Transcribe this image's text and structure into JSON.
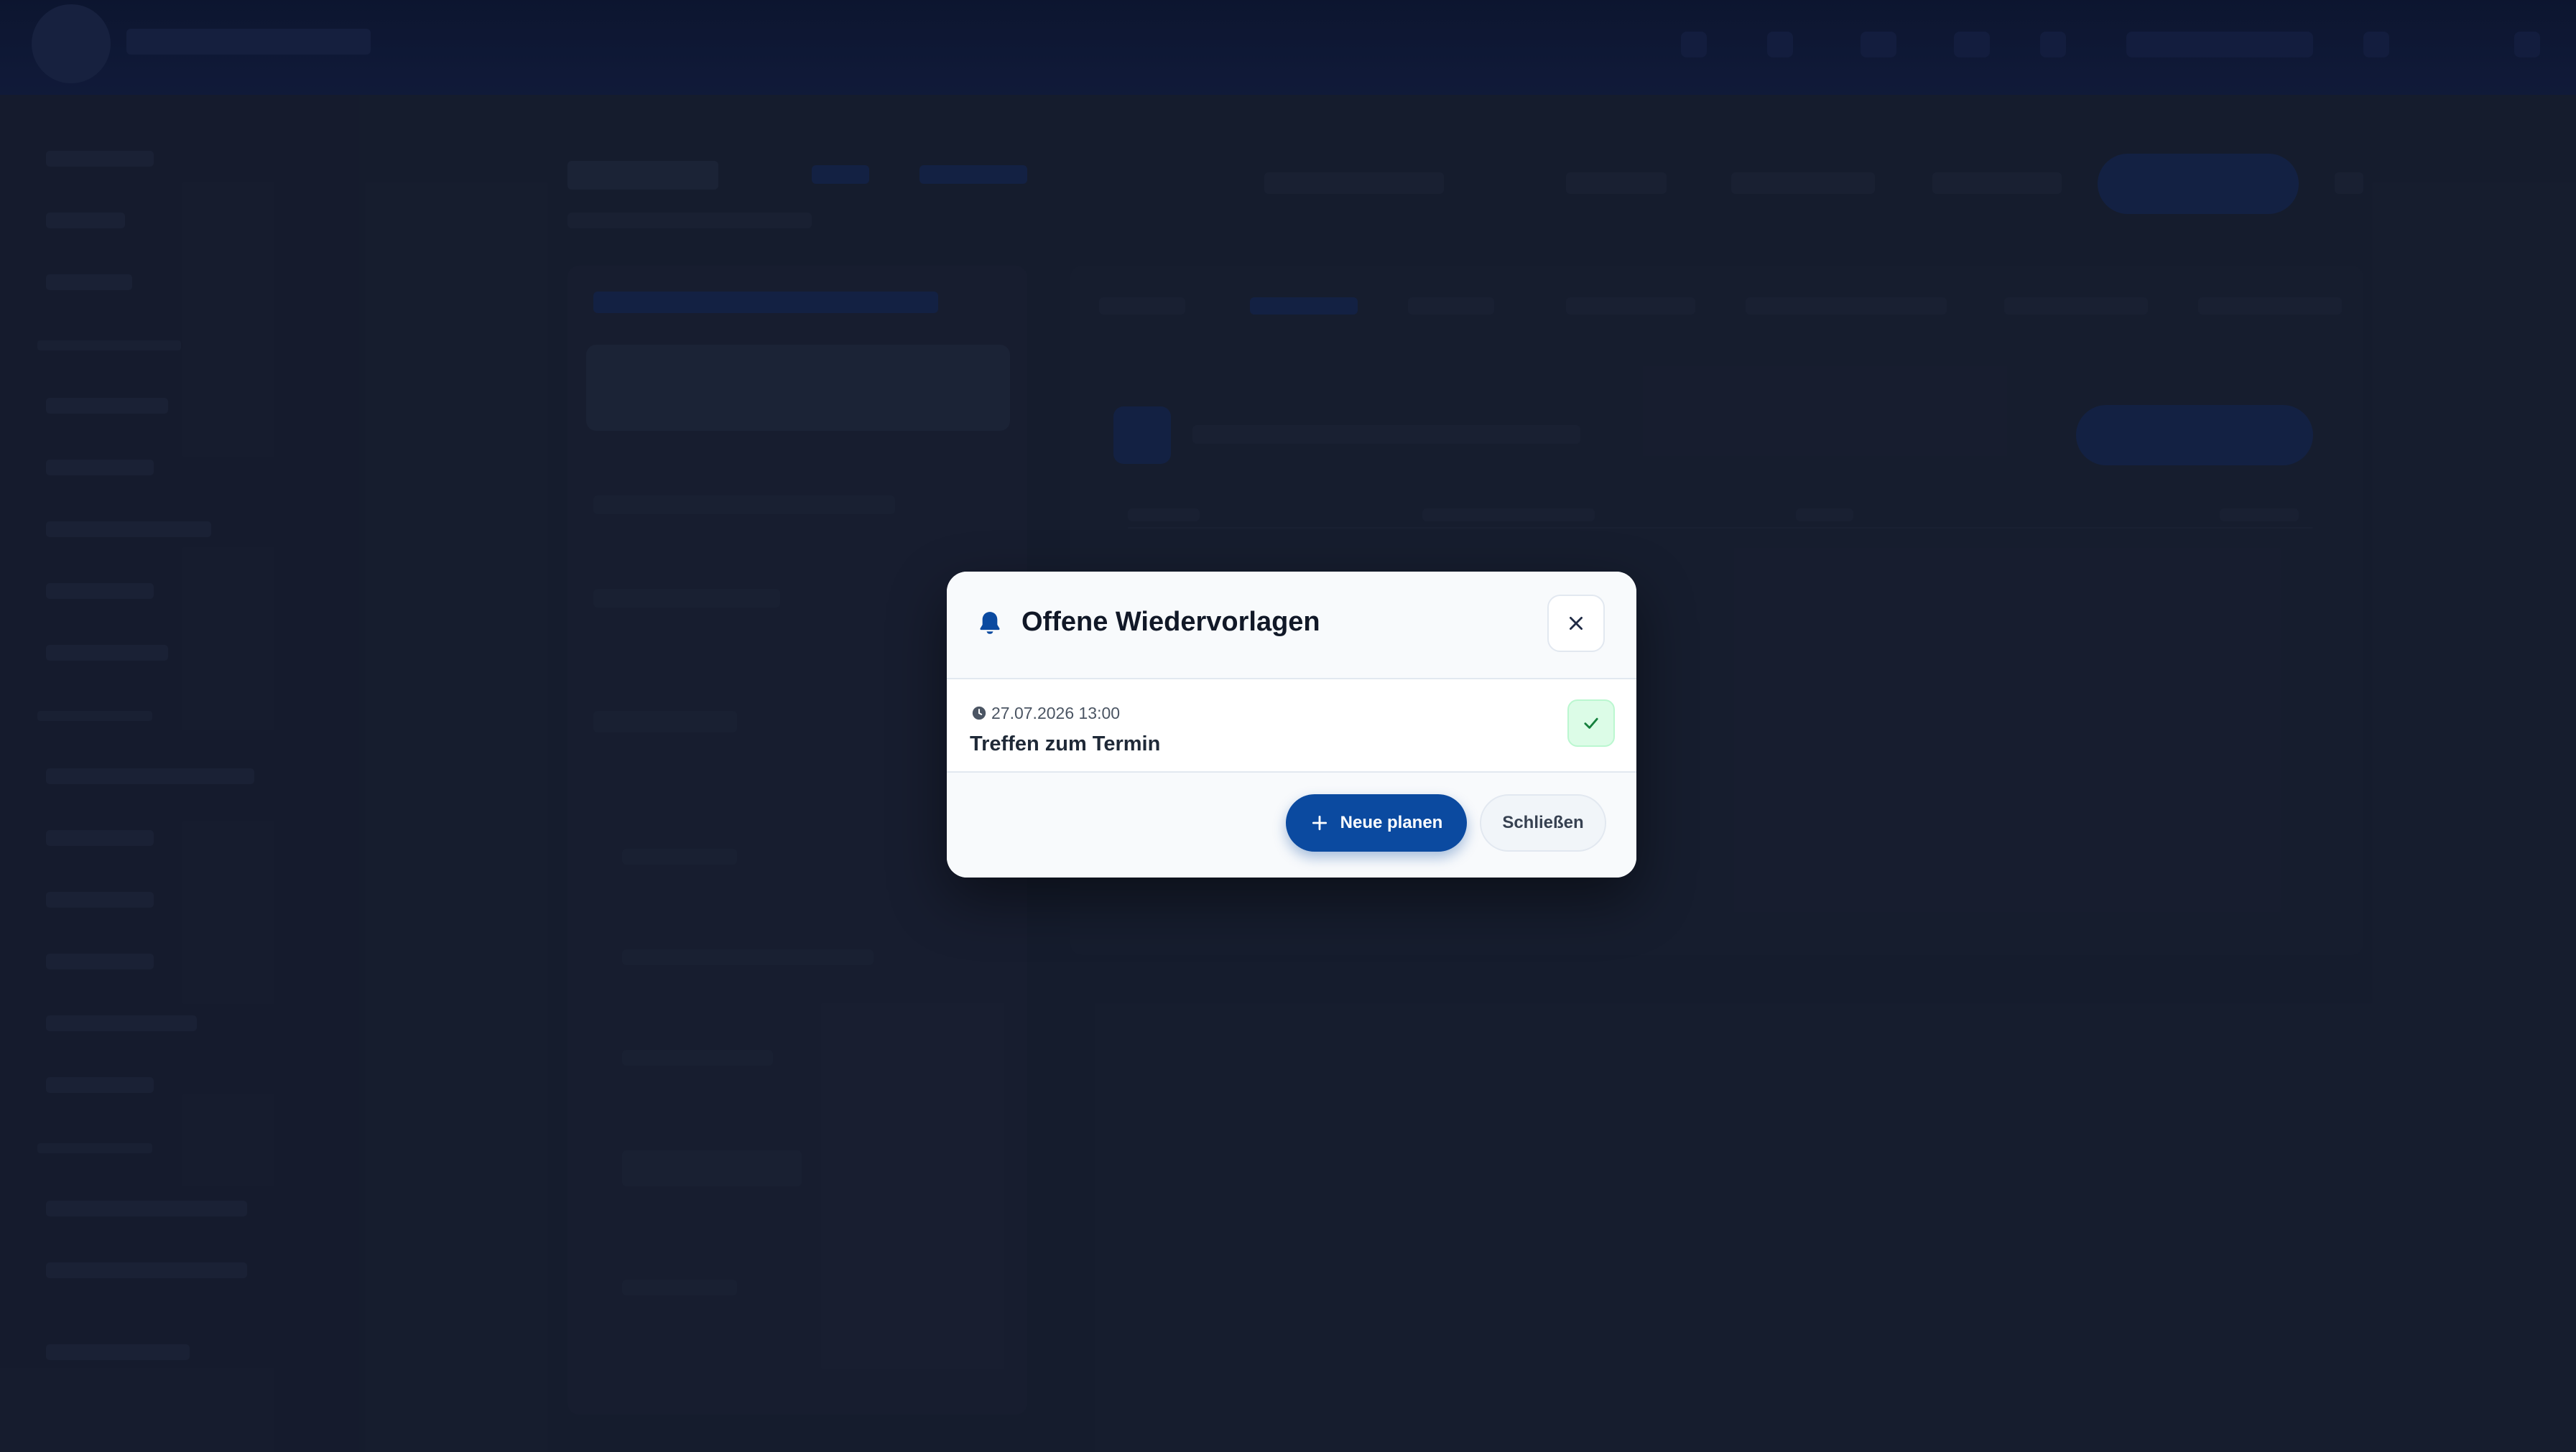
{
  "modal": {
    "title": "Offene Wiedervorlagen",
    "title_icon": "bell-icon",
    "close_icon": "close-icon",
    "entries": [
      {
        "datetime": "27.07.2026 13:00",
        "title": "Treffen zum Termin",
        "datetime_icon": "clock-icon",
        "action_icon": "check-icon"
      }
    ],
    "footer": {
      "new_button_label": "Neue planen",
      "new_button_icon": "plus-icon",
      "close_button_label": "Schließen"
    }
  },
  "colors": {
    "primary": "#0b4aa0",
    "success_bg": "#dcfce7",
    "success_fg": "#15803d",
    "backdrop": "#1d2437"
  }
}
